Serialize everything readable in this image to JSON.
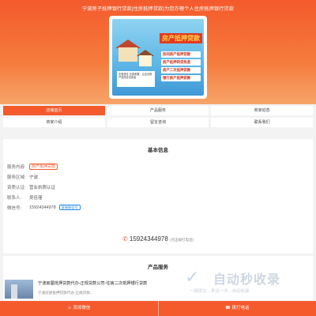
{
  "header": {
    "title": "宁波房子抵押银行贷款|住房抵押贷款|为您办理个人住房抵押银行贷款"
  },
  "banner": {
    "sign": "房产抵押贷款",
    "items": [
      "民间房产抵押贷款",
      "房产抵押转贷免息",
      "房产二次抵押贷款",
      "银行房产抵押贷款"
    ],
    "note": "无需进住 无需考察，让合法房产变成合法资金"
  },
  "nav": {
    "items": [
      "店铺首页",
      "产品服务",
      "商家动态",
      "商家介绍",
      "留言咨询",
      "联系我们"
    ],
    "active_index": 0
  },
  "basic_info": {
    "title": "基本信息",
    "service_label": "服务内容:",
    "service_value": "房产抵押贷款",
    "area_label": "服务区域:",
    "area_value": "宁波",
    "cert_label": "资质认证:",
    "cert_value": "营业执照认证",
    "contact_label": "联系人:",
    "contact_value": "吴佳瑾",
    "wechat_label": "微信号:",
    "wechat_value": "15924344978",
    "copy_label": "复制微信号",
    "phone": "15924344978",
    "phone_note": "(点击拨打电话)"
  },
  "products": {
    "title": "产品服务",
    "item_title": "宁波房屋抵押贷款代办-正规贷款公司-住房二次抵押银行贷款",
    "item_sub": "宁波房屋抵押贷款代办-正规贷款..."
  },
  "watermark": {
    "text": "自动秒收录",
    "sub": "一键提交→来访一次→自动收录"
  },
  "bottom": {
    "add_wechat": "添加微信",
    "call": "拨打电话"
  }
}
